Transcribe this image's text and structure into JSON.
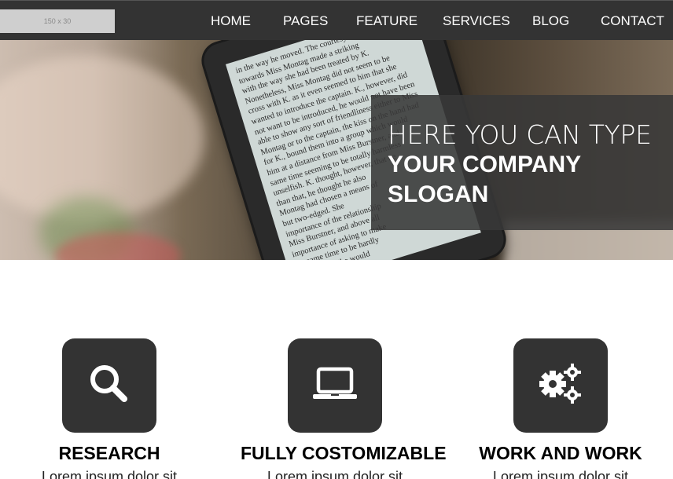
{
  "navbar": {
    "logo_placeholder": "150 x 30",
    "links": [
      "HOME",
      "PAGES",
      "FEATURE",
      "SERVICES",
      "BLOG",
      "CONTACT"
    ]
  },
  "hero": {
    "slogan_line1": "HERE YOU CAN TYPE",
    "slogan_line2": "YOUR COMPANY",
    "slogan_line3": "SLOGAN",
    "ereader_lines": [
      "in the way he moved. The courtesy",
      "towards Miss Montag made a striking",
      "with the way she had been treated by K.",
      "Nonetheless, Miss Montag did not seem to be",
      "cross with K. as it even seemed to him that she",
      "wanted to introduce the captain. K., however, did",
      "not want to be introduced, he would not have been",
      "able to show any sort of friendliness either to Miss",
      "Montag or to the captain, the kiss on the hand had",
      "for K., bound them into a group which would",
      "him at a distance from Miss Burstner, and",
      "same time seeming to be totally harmless",
      "unselfish. K. thought, however, that he",
      "than that, he thought he also",
      "Montag had chosen a means of",
      "but two-edged. She",
      "importance of the relationship",
      "Miss Burstner, and above all",
      "importance of asking to make",
      "the same time to be hardly",
      "everything. She would"
    ]
  },
  "features": [
    {
      "icon": "search-icon",
      "title": "RESEARCH",
      "text": "Lorem ipsum dolor sit"
    },
    {
      "icon": "laptop-icon",
      "title": "FULLY COSTOMIZABLE",
      "text": "Lorem ipsum dolor sit"
    },
    {
      "icon": "gears-icon",
      "title": "WORK AND WORK",
      "text": "Lorem ipsum dolor sit"
    }
  ],
  "colors": {
    "navbar_bg": "#333333",
    "icon_box_bg": "#333333",
    "slogan_overlay": "#383838"
  }
}
